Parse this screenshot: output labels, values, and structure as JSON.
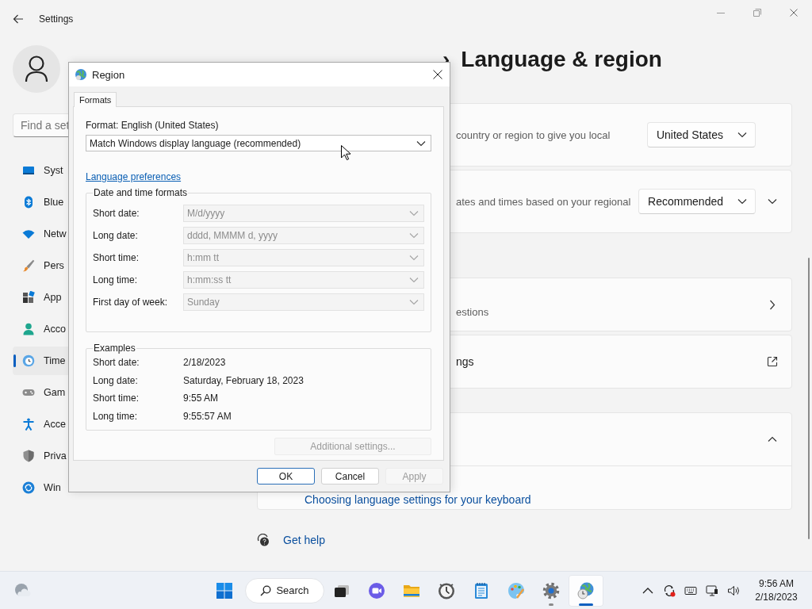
{
  "settings_window": {
    "title": "Settings",
    "search": {
      "placeholder": "Find a set"
    },
    "nav_items": [
      {
        "label": "Syst",
        "selected": false
      },
      {
        "label": "Blue",
        "selected": false
      },
      {
        "label": "Netw",
        "selected": false
      },
      {
        "label": "Pers",
        "selected": false
      },
      {
        "label": "App",
        "selected": false
      },
      {
        "label": "Acco",
        "selected": false
      },
      {
        "label": "Time",
        "selected": true
      },
      {
        "label": "Gam",
        "selected": false
      },
      {
        "label": "Acce",
        "selected": false
      },
      {
        "label": "Priva",
        "selected": false
      },
      {
        "label": "Win",
        "selected": false
      }
    ],
    "breadcrumb": {
      "separator": "›",
      "current": "Language & region"
    },
    "cards": [
      {
        "kind": "dropdown",
        "description": "country or region to give you local",
        "value": "United States"
      },
      {
        "kind": "dropdown-expander",
        "description": "ates and times based on your regional",
        "value": "Recommended",
        "expanded": false
      },
      {
        "kind": "link",
        "description": "estions"
      },
      {
        "kind": "external",
        "title": "ngs"
      },
      {
        "kind": "expander",
        "expanded": true,
        "link": "Choosing language settings for your keyboard"
      }
    ],
    "help_link": "Get help"
  },
  "region_dialog": {
    "title": "Region",
    "tabs": [
      {
        "label": "Formats",
        "selected": true
      }
    ],
    "format_label": "Format: English (United States)",
    "format_value": "Match Windows display language (recommended)",
    "language_link": "Language preferences",
    "date_time_formats": {
      "title": "Date and time formats",
      "rows": [
        {
          "label": "Short date:",
          "value": "M/d/yyyy",
          "disabled": true
        },
        {
          "label": "Long date:",
          "value": "dddd, MMMM d, yyyy",
          "disabled": true
        },
        {
          "label": "Short time:",
          "value": "h:mm tt",
          "disabled": true
        },
        {
          "label": "Long time:",
          "value": "h:mm:ss tt",
          "disabled": true
        },
        {
          "label": "First day of week:",
          "value": "Sunday",
          "disabled": true
        }
      ]
    },
    "examples": {
      "title": "Examples",
      "rows": [
        {
          "label": "Short date:",
          "value": "2/18/2023"
        },
        {
          "label": "Long date:",
          "value": "Saturday, February 18, 2023"
        },
        {
          "label": "Short time:",
          "value": "9:55 AM"
        },
        {
          "label": "Long time:",
          "value": "9:55:57 AM"
        }
      ]
    },
    "additional_settings": {
      "label": "Additional settings...",
      "disabled": true
    },
    "buttons": [
      {
        "label": "OK",
        "default": true,
        "disabled": false
      },
      {
        "label": "Cancel",
        "default": false,
        "disabled": false
      },
      {
        "label": "Apply",
        "default": false,
        "disabled": true
      }
    ]
  },
  "taskbar": {
    "apps": [
      {
        "kind": "start",
        "running": false,
        "selected": false
      },
      {
        "kind": "search",
        "label": "Search"
      },
      {
        "kind": "task-view",
        "running": false,
        "selected": false
      },
      {
        "kind": "chat",
        "running": false,
        "selected": false
      },
      {
        "kind": "folder",
        "running": false,
        "selected": false
      },
      {
        "kind": "clock",
        "running": false,
        "selected": false
      },
      {
        "kind": "notepad",
        "running": false,
        "selected": false
      },
      {
        "kind": "paint",
        "running": false,
        "selected": false
      },
      {
        "kind": "settings",
        "running": true,
        "selected": false
      },
      {
        "kind": "globe",
        "running": true,
        "selected": true
      }
    ],
    "tray": [
      {
        "kind": "chevron"
      },
      {
        "kind": "sync-alert"
      },
      {
        "kind": "keyboard"
      },
      {
        "kind": "network"
      },
      {
        "kind": "volume"
      }
    ],
    "clock": {
      "time": "9:56 AM",
      "date": "2/18/2023"
    }
  }
}
